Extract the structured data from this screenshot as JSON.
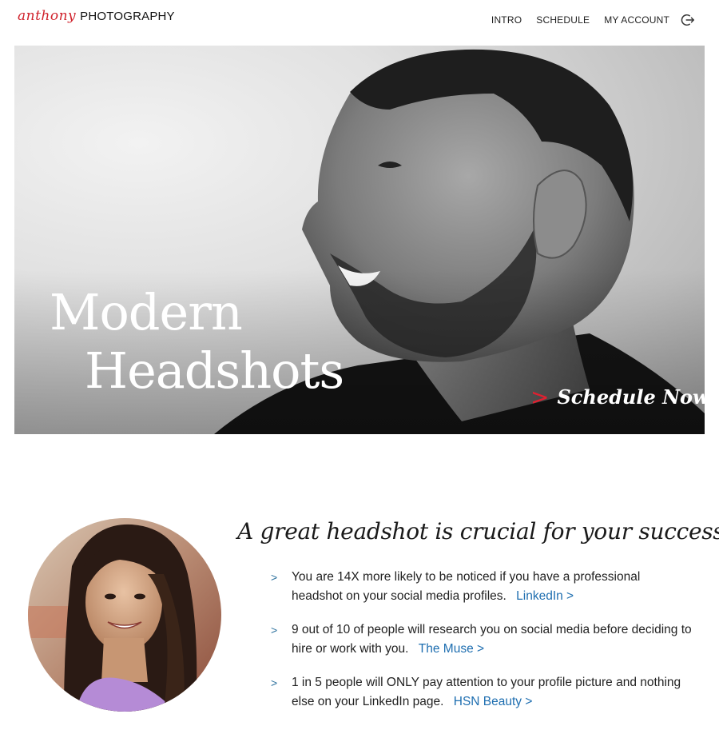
{
  "brand": {
    "script": "anthony",
    "word": "PHOTOGRAPHY",
    "accent_color": "#d0212b"
  },
  "nav": {
    "items": [
      "INTRO",
      "SCHEDULE",
      "MY ACCOUNT"
    ],
    "logout_icon": "logout-icon"
  },
  "hero": {
    "title_line1": "Modern",
    "title_line2": "Headshots",
    "cta_chevron": ">",
    "cta_label": "Schedule Now"
  },
  "info": {
    "heading": "A great headshot is crucial for your success",
    "bullet_symbol": ">",
    "points": [
      {
        "text": "You are 14X more likely to be noticed if you have a professional headshot on your social media profiles.",
        "link": "LinkedIn >"
      },
      {
        "text": "9 out of 10 of people will research you on social media before deciding to hire or work with you.",
        "link": "The Muse >"
      },
      {
        "text": "1 in 5 people will ONLY pay attention to your profile picture and nothing else on your LinkedIn page.",
        "link": "HSN Beauty >"
      }
    ],
    "link_color": "#1e6eb0"
  }
}
